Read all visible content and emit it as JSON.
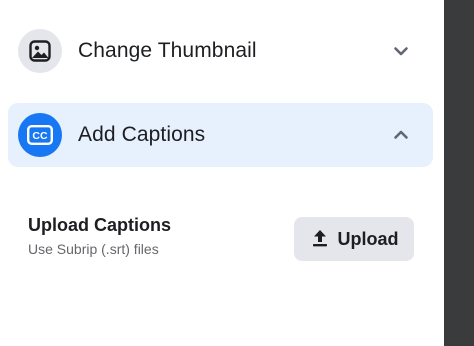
{
  "sections": {
    "thumbnail": {
      "label": "Change Thumbnail",
      "icon": "image-icon",
      "chevron": "chevron-down-icon",
      "expanded": false
    },
    "captions": {
      "label": "Add Captions",
      "icon": "closed-captions-icon",
      "icon_text": "CC",
      "chevron": "chevron-up-icon",
      "expanded": true
    }
  },
  "upload": {
    "title": "Upload Captions",
    "subtitle": "Use Subrip (.srt) files",
    "button_label": "Upload",
    "button_icon": "upload-icon"
  },
  "colors": {
    "accent": "#1877f2",
    "selected_row": "#e7f0fd",
    "button_bg": "#e4e6eb",
    "scroll_edge": "#3a3b3c"
  }
}
